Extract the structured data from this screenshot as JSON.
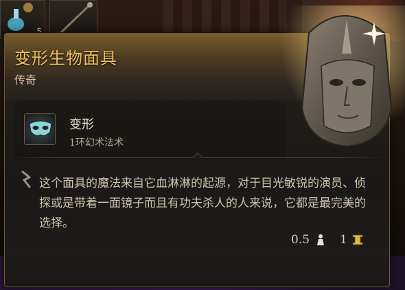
{
  "inventory": {
    "slot_count": "5"
  },
  "tooltip": {
    "title": "变形生物面具",
    "rarity": "传奇",
    "spell": {
      "name": "变形",
      "level": "1环幻术法术",
      "icon": "mask-spell-icon"
    },
    "description": "这个面具的魔法来自它血淋淋的起源，对于目光敏锐的演员、侦探或是带着一面镜子而且有功夫杀人的人来说，它都是最完美的选择。",
    "footer": {
      "weight": "0.5",
      "value": "1",
      "weight_icon": "weight-icon",
      "value_icon": "gold-coin-icon"
    },
    "item_icon": "legendary-helmet-mask"
  },
  "colors": {
    "title": "#f0c25a",
    "rarity_header": "#7a5d2a",
    "text": "#cfc3ad"
  }
}
